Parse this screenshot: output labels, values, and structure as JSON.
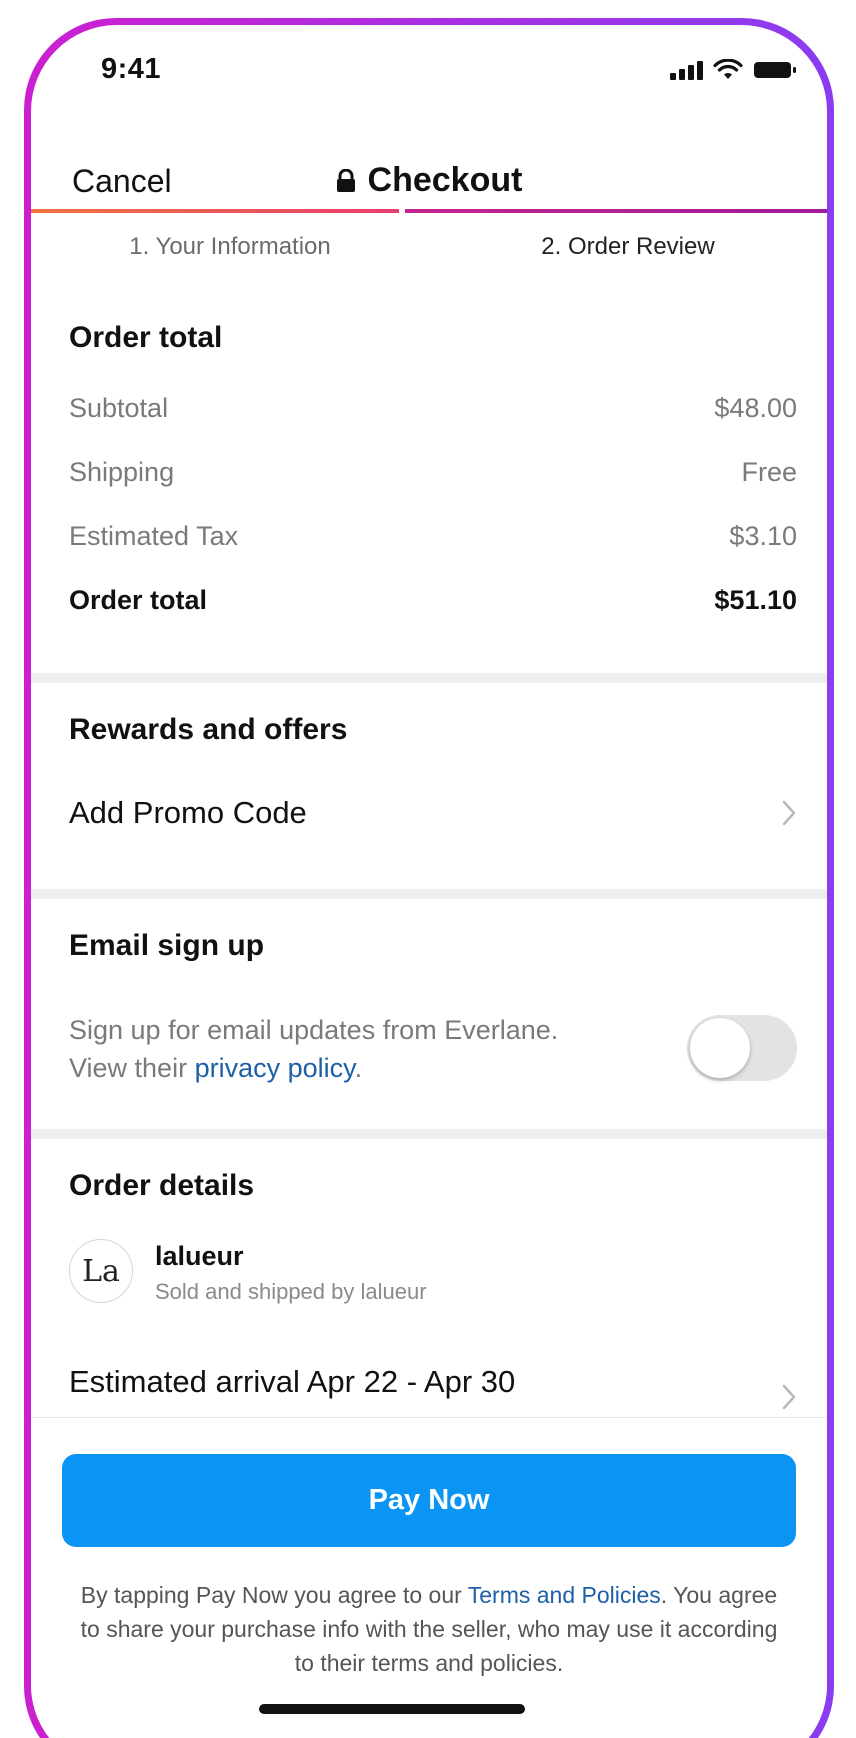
{
  "status_bar": {
    "time": "9:41"
  },
  "nav": {
    "cancel_label": "Cancel",
    "title": "Checkout"
  },
  "steps": {
    "step1": "1. Your Information",
    "step2": "2. Order Review"
  },
  "order_total": {
    "title": "Order total",
    "rows": [
      {
        "label": "Subtotal",
        "value": "$48.00"
      },
      {
        "label": "Shipping",
        "value": "Free"
      },
      {
        "label": "Estimated Tax",
        "value": "$3.10"
      }
    ],
    "total_label": "Order total",
    "total_value": "$51.10"
  },
  "rewards": {
    "title": "Rewards and offers",
    "promo_label": "Add Promo Code"
  },
  "email_signup": {
    "title": "Email sign up",
    "text_line1": "Sign up for email updates from Everlane.",
    "text_line2_prefix": "View their ",
    "privacy_link": "privacy policy",
    "text_line2_suffix": "."
  },
  "order_details": {
    "title": "Order details",
    "seller_initials": "La",
    "seller_name": "lalueur",
    "seller_sub": "Sold and shipped by lalueur",
    "arrival": "Estimated arrival Apr 22 - Apr 30"
  },
  "footer": {
    "pay_label": "Pay Now",
    "legal_prefix": "By tapping Pay Now you agree to our ",
    "legal_link": "Terms and Policies",
    "legal_suffix": ". You agree to share your purchase info with the seller, who may use it according to their terms and policies."
  },
  "colors": {
    "accent_blue": "#0a95f4",
    "link_blue": "#1f5fa8",
    "frame_left": "#cc1fd0",
    "frame_right": "#8a3df0"
  }
}
